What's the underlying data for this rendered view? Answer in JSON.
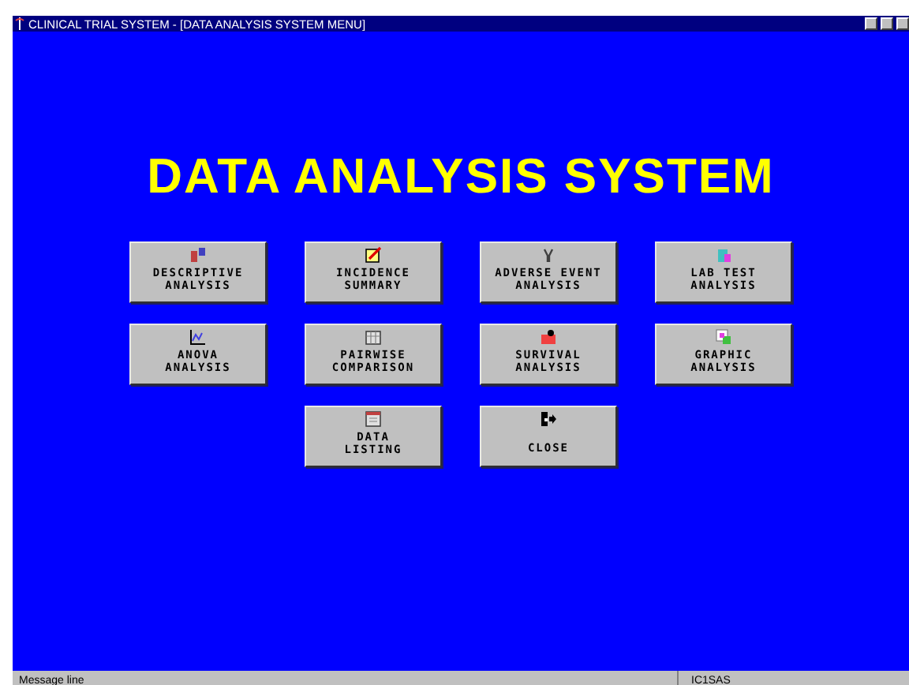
{
  "window": {
    "title": "CLINICAL TRIAL SYSTEM - [DATA ANALYSIS SYSTEM MENU]"
  },
  "heading": "DATA ANALYSIS SYSTEM",
  "buttons": [
    {
      "lines": [
        "DESCRIPTIVE",
        "ANALYSIS"
      ]
    },
    {
      "lines": [
        "INCIDENCE",
        "SUMMARY"
      ]
    },
    {
      "lines": [
        "ADVERSE EVENT",
        "ANALYSIS"
      ]
    },
    {
      "lines": [
        "LAB TEST",
        "ANALYSIS"
      ]
    },
    {
      "lines": [
        "ANOVA",
        "ANALYSIS"
      ]
    },
    {
      "lines": [
        "PAIRWISE",
        "COMPARISON"
      ]
    },
    {
      "lines": [
        "SURVIVAL",
        "ANALYSIS"
      ]
    },
    {
      "lines": [
        "GRAPHIC",
        "ANALYSIS"
      ]
    },
    {
      "lines": [
        "DATA",
        "LISTING"
      ]
    },
    {
      "lines": [
        "CLOSE"
      ]
    }
  ],
  "status_bar": {
    "message": "Message line",
    "panel": "IC1SAS"
  }
}
